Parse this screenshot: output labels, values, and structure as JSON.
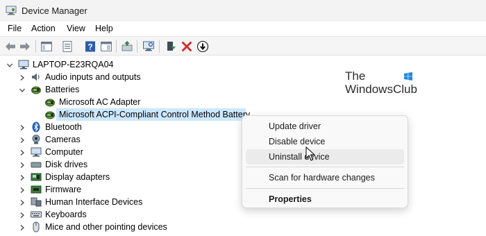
{
  "window": {
    "title": "Device Manager",
    "icon": "device-manager-icon"
  },
  "menu": [
    "File",
    "Action",
    "View",
    "Help"
  ],
  "toolbar": {
    "icons": [
      "back-arrow-icon",
      "forward-arrow-icon",
      "show-hide-console-tree-icon",
      "properties-icon",
      "help-icon",
      "action-pane-icon",
      "update-driver-icon",
      "scan-hardware-icon",
      "enable-device-icon",
      "uninstall-x-icon",
      "download-driver-icon"
    ]
  },
  "tree": {
    "root": "LAPTOP-E23RQA04",
    "items": [
      {
        "label": "Audio inputs and outputs",
        "icon": "speaker-icon",
        "expanded": false
      },
      {
        "label": "Batteries",
        "icon": "battery-icon",
        "expanded": true,
        "children": [
          {
            "label": "Microsoft AC Adapter",
            "icon": "battery-icon"
          },
          {
            "label": "Microsoft ACPI-Compliant Control Method Battery",
            "icon": "battery-icon",
            "selected": true
          }
        ]
      },
      {
        "label": "Bluetooth",
        "icon": "bluetooth-icon",
        "expanded": false
      },
      {
        "label": "Cameras",
        "icon": "camera-icon",
        "expanded": false
      },
      {
        "label": "Computer",
        "icon": "computer-icon",
        "expanded": false
      },
      {
        "label": "Disk drives",
        "icon": "disk-drive-icon",
        "expanded": false
      },
      {
        "label": "Display adapters",
        "icon": "display-adapter-icon",
        "expanded": false
      },
      {
        "label": "Firmware",
        "icon": "firmware-icon",
        "expanded": false
      },
      {
        "label": "Human Interface Devices",
        "icon": "hid-icon",
        "expanded": false
      },
      {
        "label": "Keyboards",
        "icon": "keyboard-icon",
        "expanded": false
      },
      {
        "label": "Mice and other pointing devices",
        "icon": "mouse-icon",
        "expanded": false
      }
    ]
  },
  "watermark": {
    "line1": "The",
    "line2": "WindowsClub"
  },
  "context_menu": {
    "items": [
      "Update driver",
      "Disable device",
      "Uninstall device",
      "Scan for hardware changes",
      "Properties"
    ],
    "hovered": "Uninstall device",
    "bold": "Properties"
  },
  "colors": {
    "selection": "#cce8ff",
    "menu_bg": "#f9f9f9",
    "hover": "#ebebeb",
    "uninstall_red": "#d32f2f",
    "wm_blue": "#1e88e5"
  }
}
